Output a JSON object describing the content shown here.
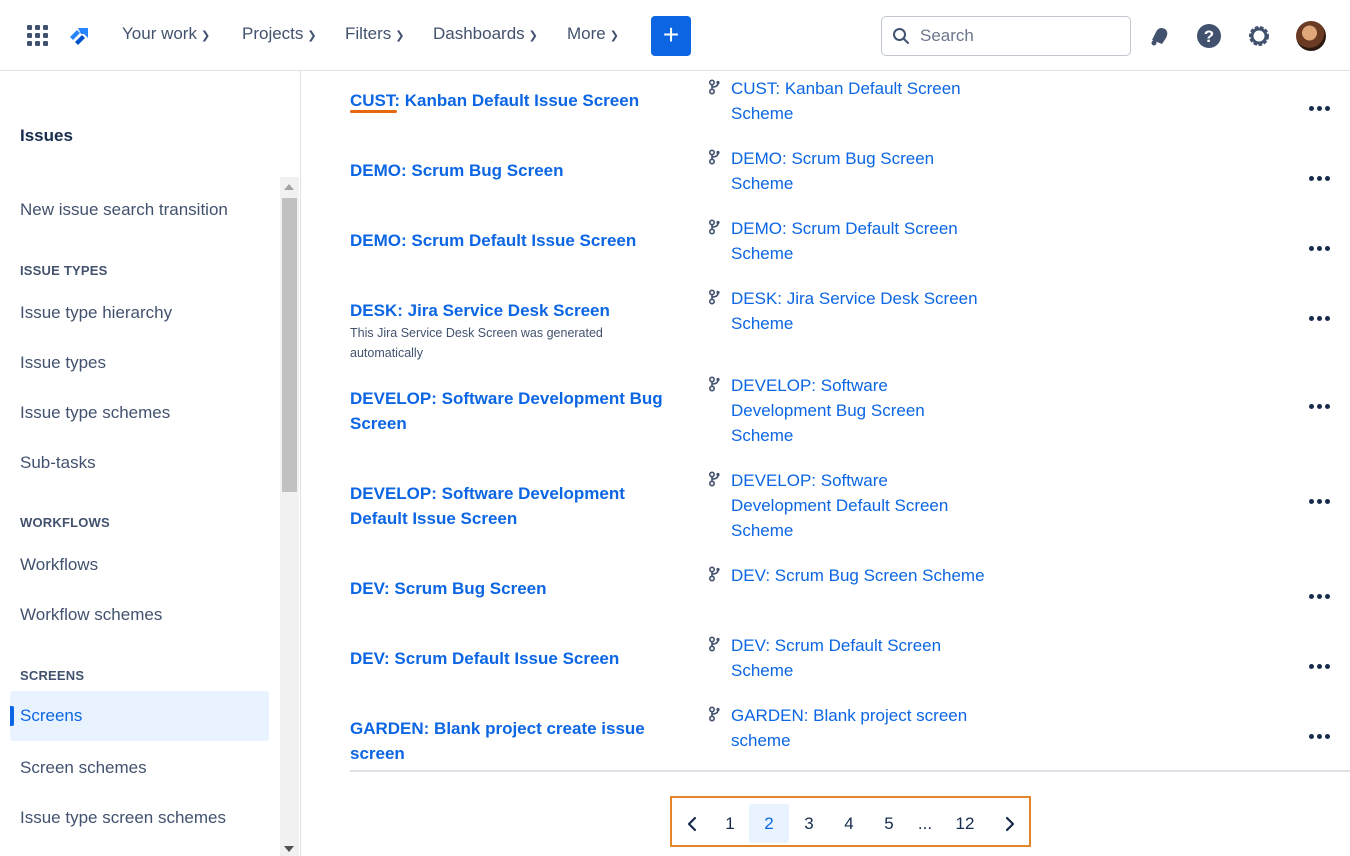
{
  "topnav": {
    "your_work": "Your work",
    "projects": "Projects",
    "filters": "Filters",
    "dashboards": "Dashboards",
    "more": "More",
    "create": "+",
    "search_placeholder": "Search",
    "accent": "#0c66e4"
  },
  "sidebar": {
    "title": "Issues",
    "items": {
      "new_issue_search": "New issue search transition",
      "issue_types_heading": "ISSUE TYPES",
      "issue_type_hierarchy": "Issue type hierarchy",
      "issue_types": "Issue types",
      "issue_type_schemes": "Issue type schemes",
      "sub_tasks": "Sub-tasks",
      "workflows_heading": "WORKFLOWS",
      "workflows": "Workflows",
      "workflow_schemes": "Workflow schemes",
      "screens_heading": "SCREENS",
      "screens": "Screens",
      "screen_schemes": "Screen schemes",
      "issue_type_screen_schemes": "Issue type screen schemes"
    }
  },
  "rows": [
    {
      "name": "CUST: Kanban Default Issue Screen",
      "desc": "",
      "scheme_lines": [
        "CUST: Kanban Default Screen",
        "Scheme"
      ]
    },
    {
      "name": "DEMO: Scrum Bug Screen",
      "desc": "",
      "scheme_lines": [
        "DEMO: Scrum Bug Screen",
        "Scheme"
      ]
    },
    {
      "name": "DEMO: Scrum Default Issue Screen",
      "desc": "",
      "scheme_lines": [
        "DEMO: Scrum Default Screen",
        "Scheme"
      ]
    },
    {
      "name": "DESK: Jira Service Desk Screen",
      "desc_lines": [
        "This Jira Service Desk Screen was generated",
        "automatically"
      ],
      "scheme_lines": [
        "DESK: Jira Service Desk Screen",
        "Scheme"
      ]
    },
    {
      "name_lines": [
        "DEVELOP: Software Development Bug",
        "Screen"
      ],
      "scheme_lines": [
        "DEVELOP: Software",
        "Development Bug Screen",
        "Scheme"
      ]
    },
    {
      "name_lines": [
        "DEVELOP: Software Development",
        "Default Issue Screen"
      ],
      "scheme_lines": [
        "DEVELOP: Software",
        "Development Default Screen",
        "Scheme"
      ]
    },
    {
      "name": "DEV: Scrum Bug Screen",
      "scheme_lines": [
        "DEV: Scrum Bug Screen Scheme"
      ]
    },
    {
      "name": "DEV: Scrum Default Issue Screen",
      "scheme_lines": [
        "DEV: Scrum Default Screen",
        "Scheme"
      ]
    },
    {
      "name_lines": [
        "GARDEN: Blank project create issue",
        "screen"
      ],
      "scheme_lines": [
        "GARDEN: Blank project screen",
        "scheme"
      ]
    }
  ],
  "pagination": {
    "pages": [
      "1",
      "2",
      "3",
      "4",
      "5",
      "...",
      "12"
    ],
    "current": "2"
  }
}
